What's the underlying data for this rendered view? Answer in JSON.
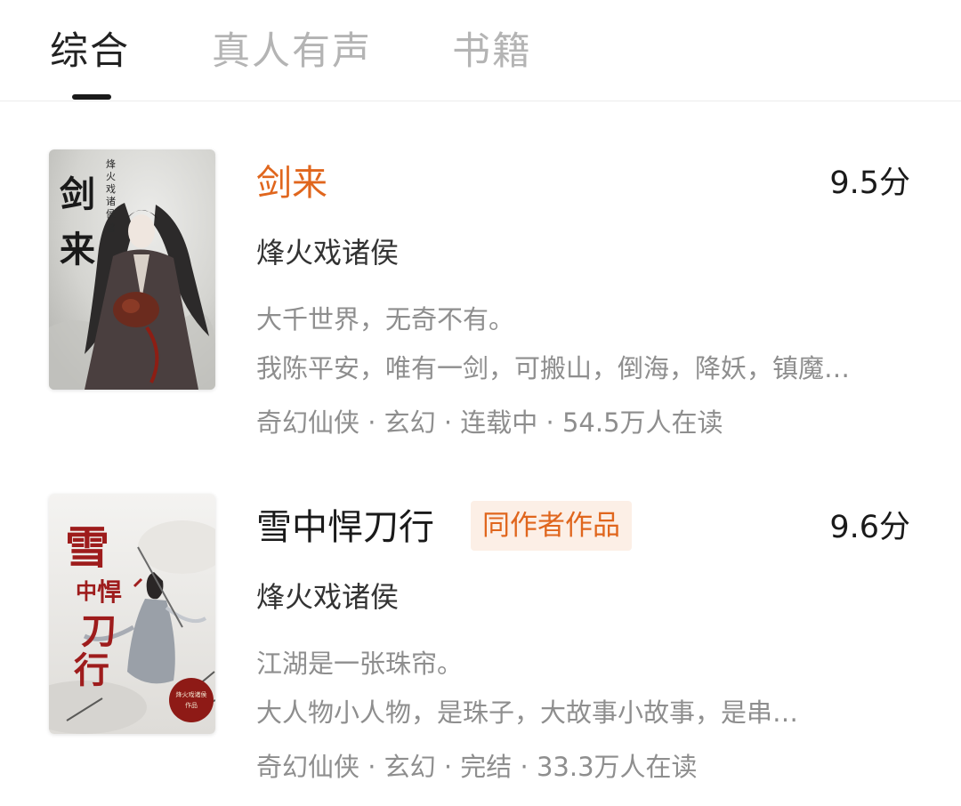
{
  "tabs": [
    {
      "label": "综合",
      "active": true
    },
    {
      "label": "真人有声",
      "active": false
    },
    {
      "label": "书籍",
      "active": false
    }
  ],
  "books": [
    {
      "title": "剑来",
      "title_highlighted": true,
      "badge": "",
      "score": "9.5分",
      "author": "烽火戏诸侯",
      "desc_line1": "大千世界，无奇不有。",
      "desc_line2": "我陈平安，唯有一剑，可搬山，倒海，降妖，镇魔…",
      "meta": "奇幻仙侠 · 玄幻 · 连载中 · 54.5万人在读",
      "cover": {
        "title_chars": "剑来",
        "author_vertical": "烽火戏诸侯著",
        "theme": "grey ink, dark-robed swordsman"
      }
    },
    {
      "title": "雪中悍刀行",
      "title_highlighted": false,
      "badge": "同作者作品",
      "score": "9.6分",
      "author": "烽火戏诸侯",
      "desc_line1": "江湖是一张珠帘。",
      "desc_line2": "大人物小人物，是珠子，大故事小故事，是串…",
      "meta": "奇幻仙侠 · 玄幻 · 完结 · 33.3万人在读",
      "cover": {
        "title_chars": "雪中悍刀行",
        "seal_text": "烽火戏诸侯作品",
        "theme": "snow, red calligraphy"
      }
    }
  ],
  "colors": {
    "accent": "#e0661d",
    "badge_bg": "#fcefe6",
    "text_primary": "#1a1a1a",
    "text_secondary": "#8e8e8e",
    "tab_inactive": "#b4b4b4"
  }
}
